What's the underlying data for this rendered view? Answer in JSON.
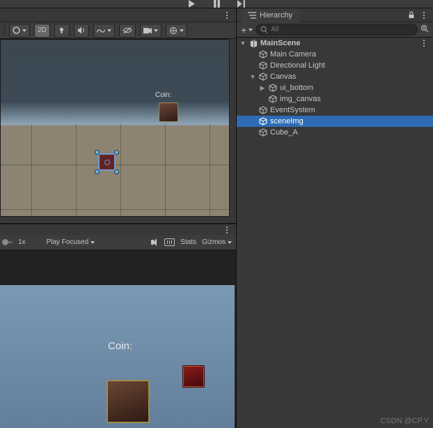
{
  "transport": {
    "play": "play-icon",
    "pause": "pause-icon",
    "step": "step-icon"
  },
  "scene_toolbar": {
    "mode_2d": "2D"
  },
  "scene": {
    "coin_label": "Coin:"
  },
  "game_toolbar": {
    "scale": "1x",
    "play_mode": "Play Focused",
    "stats": "Stats",
    "gizmos": "Gizmos"
  },
  "game": {
    "coin_label": "Coin:"
  },
  "hierarchy": {
    "tab_label": "Hierarchy",
    "search_placeholder": "All",
    "nodes": [
      {
        "label": "MainScene",
        "kind": "scene"
      },
      {
        "label": "Main Camera",
        "kind": "go"
      },
      {
        "label": "Directional Light",
        "kind": "go"
      },
      {
        "label": "Canvas",
        "kind": "go"
      },
      {
        "label": "ui_bottom",
        "kind": "go"
      },
      {
        "label": "img_canvas",
        "kind": "go"
      },
      {
        "label": "EventSystem",
        "kind": "go"
      },
      {
        "label": "sceneImg",
        "kind": "go"
      },
      {
        "label": "Cube_A",
        "kind": "go"
      }
    ]
  },
  "watermark": "CSDN @CP.Y"
}
